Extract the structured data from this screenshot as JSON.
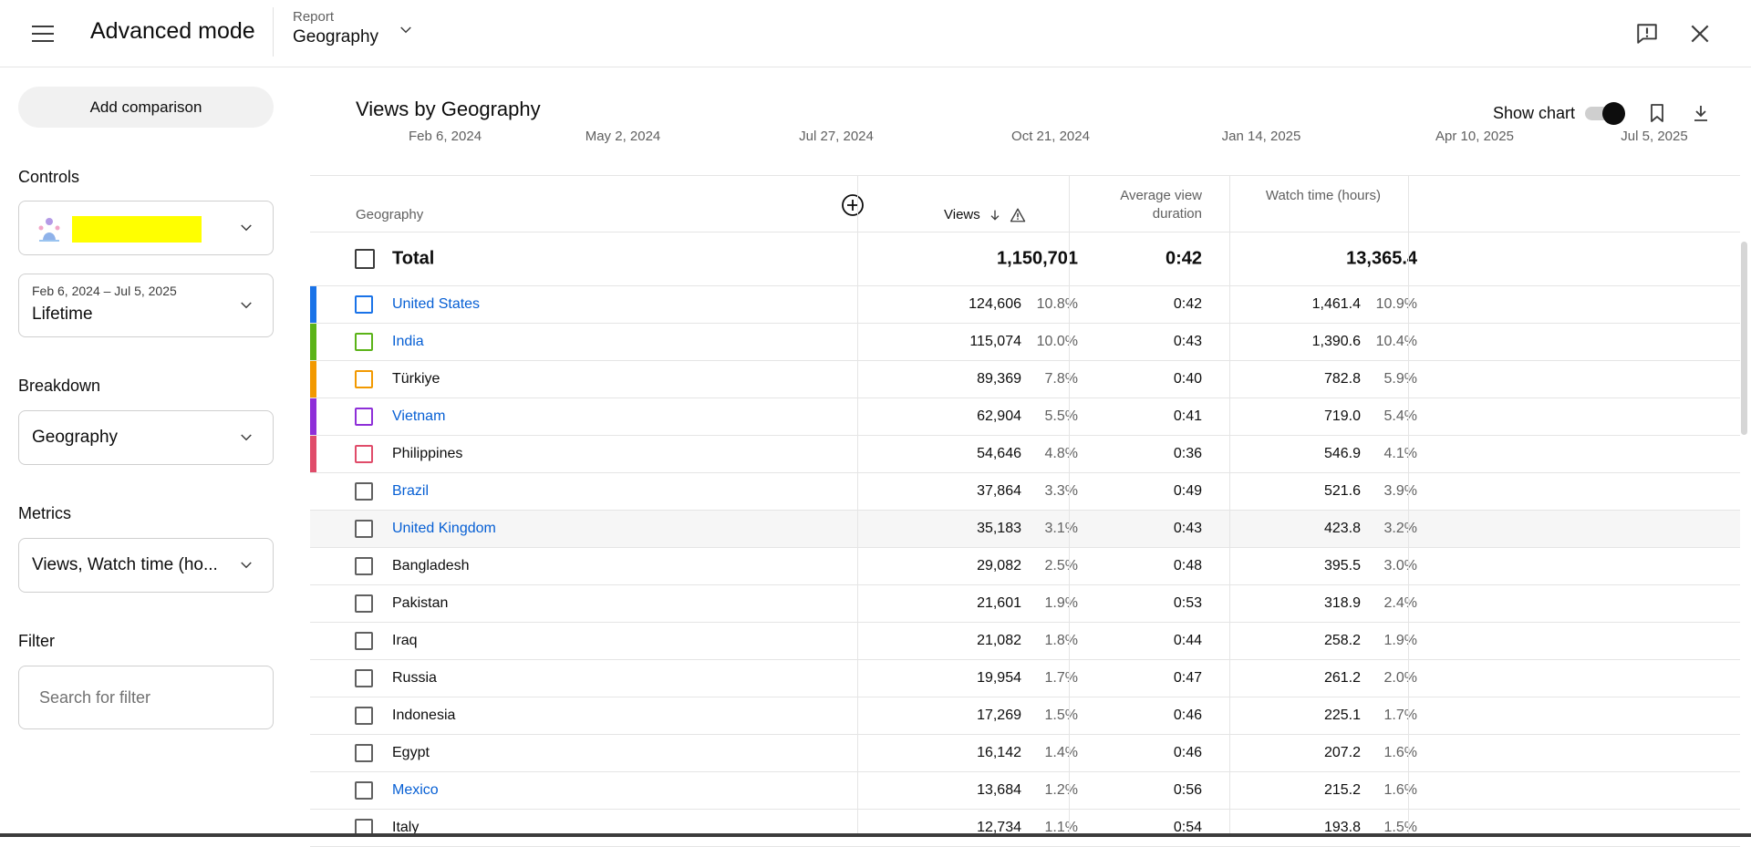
{
  "header": {
    "title": "Advanced mode",
    "report_caption": "Report",
    "report_value": "Geography"
  },
  "sidebar": {
    "add_comparison": "Add comparison",
    "controls_label": "Controls",
    "date_range": "Feb 6, 2024 – Jul 5, 2025",
    "period": "Lifetime",
    "breakdown_label": "Breakdown",
    "breakdown_value": "Geography",
    "metrics_label": "Metrics",
    "metrics_value": "Views, Watch time (ho...",
    "filter_label": "Filter",
    "filter_placeholder": "Search for filter"
  },
  "main": {
    "title": "Views by Geography",
    "show_chart_label": "Show chart",
    "show_chart_on": true,
    "axis_dates": [
      "Feb 6, 2024",
      "May 2, 2024",
      "Jul 27, 2024",
      "Oct 21, 2024",
      "Jan 14, 2025",
      "Apr 10, 2025",
      "Jul 5, 2025"
    ]
  },
  "table": {
    "columns": {
      "geography": "Geography",
      "views": "Views",
      "avg_view_duration": "Average view duration",
      "watch_time": "Watch time (hours)"
    },
    "total": {
      "label": "Total",
      "views": "1,150,701",
      "avg": "0:42",
      "watch": "13,365.4"
    },
    "rows": [
      {
        "name": "United States",
        "link": true,
        "color": "#1a73e8",
        "views": "124,606",
        "views_pct": "10.8%",
        "avg": "0:42",
        "watch": "1,461.4",
        "watch_pct": "10.9%"
      },
      {
        "name": "India",
        "link": true,
        "color": "#5bb318",
        "views": "115,074",
        "views_pct": "10.0%",
        "avg": "0:43",
        "watch": "1,390.6",
        "watch_pct": "10.4%"
      },
      {
        "name": "Türkiye",
        "link": false,
        "color": "#f29900",
        "views": "89,369",
        "views_pct": "7.8%",
        "avg": "0:40",
        "watch": "782.8",
        "watch_pct": "5.9%"
      },
      {
        "name": "Vietnam",
        "link": true,
        "color": "#8e2fd8",
        "views": "62,904",
        "views_pct": "5.5%",
        "avg": "0:41",
        "watch": "719.0",
        "watch_pct": "5.4%"
      },
      {
        "name": "Philippines",
        "link": false,
        "color": "#e04c6a",
        "views": "54,646",
        "views_pct": "4.8%",
        "avg": "0:36",
        "watch": "546.9",
        "watch_pct": "4.1%"
      },
      {
        "name": "Brazil",
        "link": true,
        "color": "",
        "views": "37,864",
        "views_pct": "3.3%",
        "avg": "0:49",
        "watch": "521.6",
        "watch_pct": "3.9%"
      },
      {
        "name": "United Kingdom",
        "link": true,
        "color": "",
        "views": "35,183",
        "views_pct": "3.1%",
        "avg": "0:43",
        "watch": "423.8",
        "watch_pct": "3.2%"
      },
      {
        "name": "Bangladesh",
        "link": false,
        "color": "",
        "views": "29,082",
        "views_pct": "2.5%",
        "avg": "0:48",
        "watch": "395.5",
        "watch_pct": "3.0%"
      },
      {
        "name": "Pakistan",
        "link": false,
        "color": "",
        "views": "21,601",
        "views_pct": "1.9%",
        "avg": "0:53",
        "watch": "318.9",
        "watch_pct": "2.4%"
      },
      {
        "name": "Iraq",
        "link": false,
        "color": "",
        "views": "21,082",
        "views_pct": "1.8%",
        "avg": "0:44",
        "watch": "258.2",
        "watch_pct": "1.9%"
      },
      {
        "name": "Russia",
        "link": false,
        "color": "",
        "views": "19,954",
        "views_pct": "1.7%",
        "avg": "0:47",
        "watch": "261.2",
        "watch_pct": "2.0%"
      },
      {
        "name": "Indonesia",
        "link": false,
        "color": "",
        "views": "17,269",
        "views_pct": "1.5%",
        "avg": "0:46",
        "watch": "225.1",
        "watch_pct": "1.7%"
      },
      {
        "name": "Egypt",
        "link": false,
        "color": "",
        "views": "16,142",
        "views_pct": "1.4%",
        "avg": "0:46",
        "watch": "207.2",
        "watch_pct": "1.6%"
      },
      {
        "name": "Mexico",
        "link": true,
        "color": "",
        "views": "13,684",
        "views_pct": "1.2%",
        "avg": "0:56",
        "watch": "215.2",
        "watch_pct": "1.6%"
      },
      {
        "name": "Italy",
        "link": false,
        "color": "",
        "views": "12,734",
        "views_pct": "1.1%",
        "avg": "0:54",
        "watch": "193.8",
        "watch_pct": "1.5%"
      }
    ]
  },
  "icons": {
    "menu": "hamburger-menu-icon",
    "report_dropdown": "chevron-down-icon",
    "feedback": "feedback-icon",
    "close": "close-icon",
    "bookmark": "bookmark-icon",
    "download": "download-icon",
    "add_metric": "plus-circle-icon",
    "sort": "arrow-down-icon",
    "warning": "warning-icon"
  }
}
